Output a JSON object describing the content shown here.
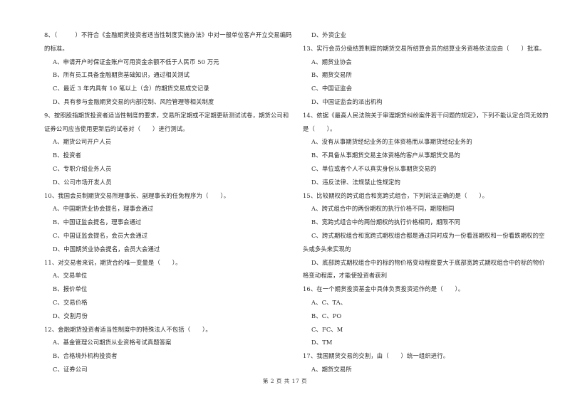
{
  "page": {
    "footer": "第 2 页 共 17 页"
  },
  "left_column": [
    {
      "type": "q",
      "text": "8、（　　　）不符合《金融期货投资者适当性制度实施办法》中对一般单位客户开立交易编码"
    },
    {
      "type": "cont",
      "text": "的标准。"
    },
    {
      "type": "opt",
      "text": "A、申请开户时保证金账户可用资金余额不低于人民币 50 万元"
    },
    {
      "type": "opt",
      "text": "B、所有员工具备金融期货基础知识，通过相关测试"
    },
    {
      "type": "opt",
      "text": "C、最近 3 年内具有 10 笔以上（含）的期货交易成交记录"
    },
    {
      "type": "opt",
      "text": "D、具有参与金融期货交易的内部控制、风险管理等相关制度"
    },
    {
      "type": "q",
      "text": "9、按照股指期货投资者适当性制度的要求，交易所定期或不定期更新测试试卷，期货公司和"
    },
    {
      "type": "cont",
      "text": "证券公司应当使用更新后的试卷对（　　）进行测试。"
    },
    {
      "type": "opt",
      "text": "A、期货公司开户人员"
    },
    {
      "type": "opt",
      "text": "B、投资者"
    },
    {
      "type": "opt",
      "text": "C、专职介绍业务人员"
    },
    {
      "type": "opt",
      "text": "D、公司市场开发人员"
    },
    {
      "type": "q",
      "text": "10、我国会员制期货交易所理事长、副理事长的任免程序为（　　）。"
    },
    {
      "type": "opt",
      "text": "A、中国期货业协会提名，理事会通过"
    },
    {
      "type": "opt",
      "text": "B、中国证监会提名，理事会通过"
    },
    {
      "type": "opt",
      "text": "C、中国证监会提名，会员大会通过"
    },
    {
      "type": "opt",
      "text": "D、中国期货业协会提名，会员大会通过"
    },
    {
      "type": "q",
      "text": "11、对交易者来说，期货合约唯一变量是（　　）。"
    },
    {
      "type": "opt",
      "text": "A、交易单位"
    },
    {
      "type": "opt",
      "text": "B、报价单位"
    },
    {
      "type": "opt",
      "text": "C、交易价格"
    },
    {
      "type": "opt",
      "text": "D、交割月份"
    },
    {
      "type": "q",
      "text": "12、金融期货投资者适当性制度中的特殊法人不包括（　　）。"
    },
    {
      "type": "opt",
      "text": "A、基金管理公司期货从业资格考试真题答案"
    },
    {
      "type": "opt",
      "text": "B、合格境外机构投资者"
    },
    {
      "type": "opt",
      "text": "C、证券公司"
    }
  ],
  "right_column": [
    {
      "type": "opt",
      "text": "D、外资企业"
    },
    {
      "type": "q",
      "text": "13、实行会员分级结算制度的期货交易所结算会员的结算业务资格依法应由（　　）批准。"
    },
    {
      "type": "opt",
      "text": "A、期货业协会"
    },
    {
      "type": "opt",
      "text": "B、期货交易所"
    },
    {
      "type": "opt",
      "text": "C、中国证监会"
    },
    {
      "type": "opt",
      "text": "D、中国证监会的派出机构"
    },
    {
      "type": "q",
      "text": "14、依据《最高人民法院关于审理期货纠纷案件若干问题的规定》，下列不能认定合同无效的"
    },
    {
      "type": "cont",
      "text": "是（　　）。"
    },
    {
      "type": "opt",
      "text": "A、没有从事期货经纪业务的主体资格而从事期货经纪业务的"
    },
    {
      "type": "opt",
      "text": "B、不具备从事期货交易主体资格的客户从事期货交易的"
    },
    {
      "type": "opt",
      "text": "C、单位或者个人不以真实身份从事期货交易的"
    },
    {
      "type": "opt",
      "text": "D、违反法律、法规禁止性规定的"
    },
    {
      "type": "q",
      "text": "15、比较期权的跨式组合和宽跨式组合，下列说法正确的是（　　）。"
    },
    {
      "type": "opt",
      "text": "A、跨式组合中的两份期权的执行价格不同，期限相同"
    },
    {
      "type": "opt",
      "text": "B、宽跨式组合中的两份期权的执行价格相同，期限不同"
    },
    {
      "type": "opt",
      "text": "C、跨式期权组合和宽跨式期权组合都是通过同时成为一份看涨期权和一份看跌期权的空"
    },
    {
      "type": "cont",
      "text": "头或多头来实现的"
    },
    {
      "type": "opt",
      "text": "D、底部跨式期权组合中的标的物价格变动程度要大于底部宽跨式期权组合中的标的物价"
    },
    {
      "type": "cont",
      "text": "格变动程度，才能使投资者获利"
    },
    {
      "type": "q",
      "text": "16、在一个期货投资基金中具体负责投资运作的是（　　）。"
    },
    {
      "type": "opt",
      "text": "A、C、TA、"
    },
    {
      "type": "opt",
      "text": "B、C、PO"
    },
    {
      "type": "opt",
      "text": "C、FC、M"
    },
    {
      "type": "opt",
      "text": "D、TM"
    },
    {
      "type": "q",
      "text": "17、我国期货交易的交割，由（　　）统一组织进行。"
    },
    {
      "type": "opt",
      "text": "A、期货交易所"
    }
  ]
}
